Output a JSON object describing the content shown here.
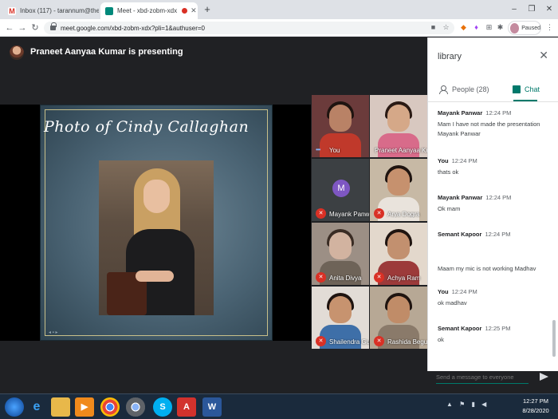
{
  "browser": {
    "tabs": [
      {
        "title": "Inbox (117) - tarannum@theindi",
        "icon": "gmail-icon"
      },
      {
        "title": "Meet - xbd-zobm-xdx",
        "icon": "meet-icon"
      }
    ],
    "url": "meet.google.com/xbd-zobm-xdx?pli=1&authuser=0",
    "profile_status": "Paused",
    "icons": [
      "back-icon",
      "forward-icon",
      "reload-icon",
      "lock-icon",
      "cast-icon",
      "star-icon",
      "extensions-icon",
      "menu-icon"
    ]
  },
  "meeting": {
    "presenter_banner": "Praneet Aanyaa Kumar is presenting",
    "slide": {
      "title": "Photo of Cindy Callaghan"
    },
    "participants": [
      {
        "name": "You",
        "muted": false
      },
      {
        "name": "Praneet Aanyaa Kumar",
        "muted": false
      },
      {
        "name": "Mayank Panwar",
        "muted": true,
        "initial": "M"
      },
      {
        "name": "Arya Dogra",
        "muted": true
      },
      {
        "name": "Anita Divya",
        "muted": true
      },
      {
        "name": "Achya Ram",
        "muted": true
      },
      {
        "name": "Shailendra Gu...",
        "muted": true
      },
      {
        "name": "Rashida Begum",
        "muted": true
      }
    ]
  },
  "panel": {
    "title": "library",
    "people_tab": "People (28)",
    "chat_tab": "Chat",
    "messages": [
      {
        "sender": "Mayank Panwar",
        "time": "12:24 PM",
        "text": "Mam I have not made the presentation Mayank Panwar"
      },
      {
        "sender": "You",
        "time": "12:24 PM",
        "text": "thats ok"
      },
      {
        "sender": "Mayank Panwar",
        "time": "12:24 PM",
        "text": "Ok mam"
      },
      {
        "sender": "Semant Kapoor",
        "time": "12:24 PM",
        "text": ""
      },
      {
        "sender": "",
        "time": "",
        "text": "Maam my mic is not working Madhav"
      },
      {
        "sender": "You",
        "time": "12:24 PM",
        "text": "ok madhav"
      },
      {
        "sender": "Semant Kapoor",
        "time": "12:25 PM",
        "text": "ok"
      }
    ],
    "compose_placeholder": "Send a message to everyone"
  },
  "taskbar": {
    "apps": [
      "ie-icon",
      "file-explorer-icon",
      "media-player-icon",
      "chrome-icon",
      "chrome-alt-icon",
      "skype-icon",
      "acrobat-icon",
      "word-icon"
    ],
    "clock_time": "12:27 PM",
    "clock_date": "8/28/2020"
  },
  "colors": {
    "accent": "#00796b",
    "muted_red": "#d93025",
    "stage_bg": "#202124"
  }
}
